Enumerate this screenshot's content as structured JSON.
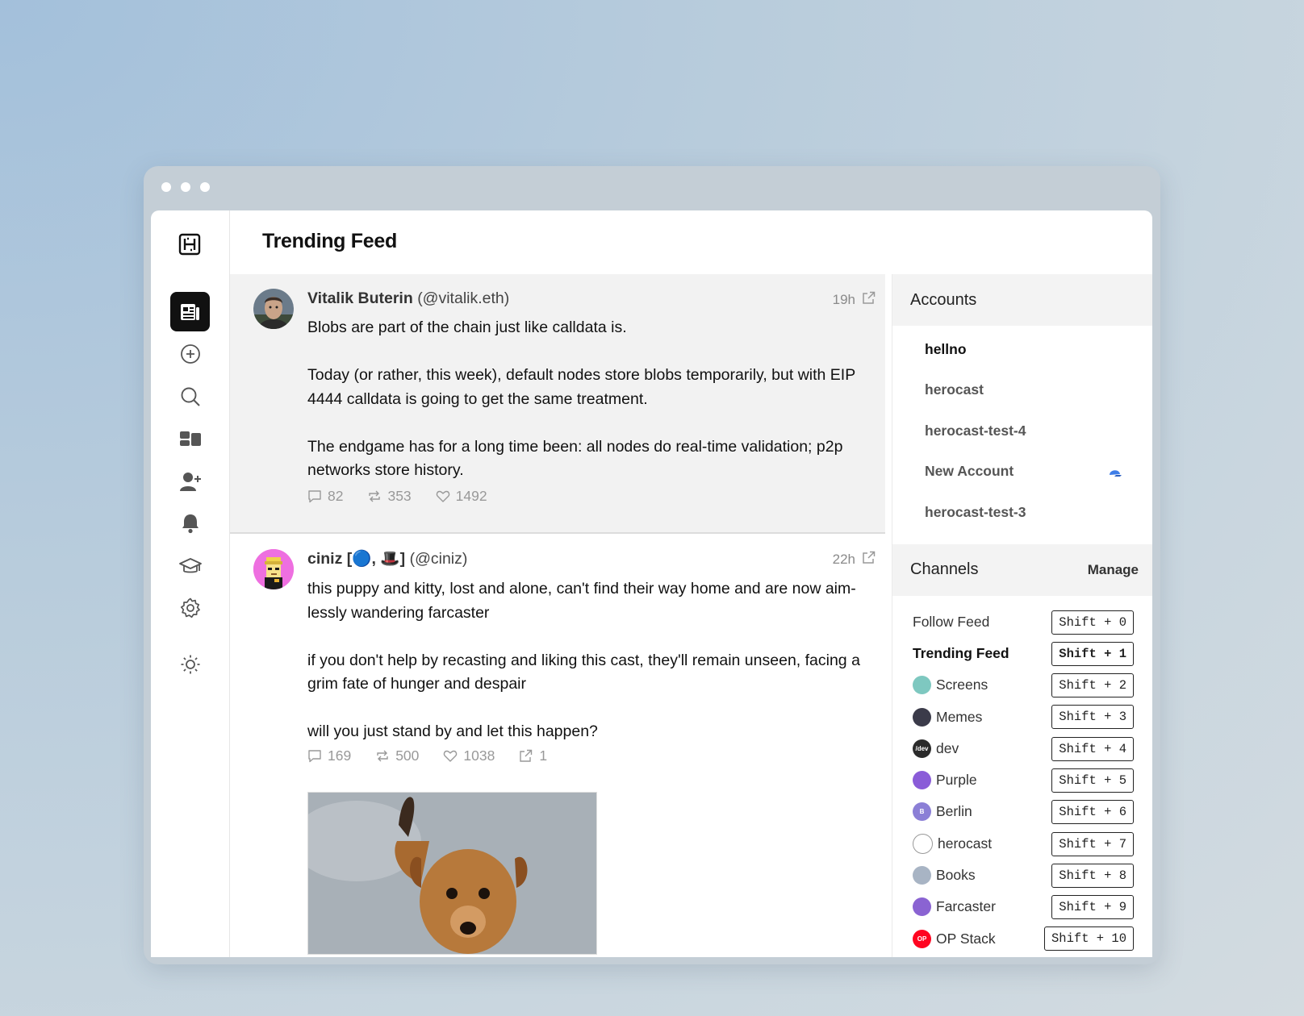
{
  "header": {
    "title": "Trending Feed"
  },
  "rail": {
    "items": [
      {
        "icon": "feed-icon",
        "active": true
      },
      {
        "icon": "plus-circle-icon"
      },
      {
        "icon": "search-icon"
      },
      {
        "icon": "channels-icon"
      },
      {
        "icon": "add-user-icon"
      },
      {
        "icon": "bell-icon"
      },
      {
        "icon": "graduation-cap-icon"
      },
      {
        "icon": "gear-icon"
      },
      {
        "icon": "sun-icon"
      }
    ]
  },
  "casts": [
    {
      "name": "Vitalik Buterin",
      "handle": "(@vitalik.eth)",
      "time": "19h",
      "paragraphs": [
        "Blobs are part of the chain just like calldata is.",
        "Today (or rather, this week), default nodes store blobs temporarily, but with EIP 4444 calldata is going to get the same treatment.",
        "The endgame has for a long time been: all nodes do real-time validation; p2p networks store history."
      ],
      "replies": "82",
      "recasts": "353",
      "likes": "1492"
    },
    {
      "name": "ciniz [🔵, 🎩]",
      "handle": "(@ciniz)",
      "time": "22h",
      "paragraphs": [
        "this puppy and kitty, lost and alone, can't find their way home and are now aim-lessly wandering farcaster",
        "if you don't help by recasting and liking this cast, they'll remain unseen, facing a grim fate of hunger and despair",
        "will you just stand by and let this happen?"
      ],
      "replies": "169",
      "recasts": "500",
      "likes": "1038",
      "shares": "1"
    }
  ],
  "accounts": {
    "heading": "Accounts",
    "items": [
      "hellno",
      "herocast",
      "herocast-test-4",
      "New Account",
      "herocast-test-3"
    ]
  },
  "channels": {
    "heading": "Channels",
    "manage": "Manage",
    "items": [
      {
        "label": "Follow Feed",
        "shortcut": "Shift + 0"
      },
      {
        "label": "Trending Feed",
        "shortcut": "Shift + 1"
      },
      {
        "label": "Screens",
        "shortcut": "Shift + 2",
        "color": "#7ec8c0"
      },
      {
        "label": "Memes",
        "shortcut": "Shift + 3",
        "color": "#3b3b4a"
      },
      {
        "label": "dev",
        "shortcut": "Shift + 4",
        "color": "#2b2b2b",
        "badge": "/dev"
      },
      {
        "label": "Purple",
        "shortcut": "Shift + 5",
        "color": "#8a5cd8"
      },
      {
        "label": "Berlin",
        "shortcut": "Shift + 6",
        "color": "#8b7fd6",
        "badge": "B"
      },
      {
        "label": "herocast",
        "shortcut": "Shift + 7",
        "color": "#ffffff"
      },
      {
        "label": "Books",
        "shortcut": "Shift + 8",
        "color": "#a8b4c4"
      },
      {
        "label": "Farcaster",
        "shortcut": "Shift + 9",
        "color": "#8a63d2"
      },
      {
        "label": "OP Stack",
        "shortcut": "Shift + 10",
        "color": "#ff0420",
        "badge": "OP"
      }
    ]
  }
}
